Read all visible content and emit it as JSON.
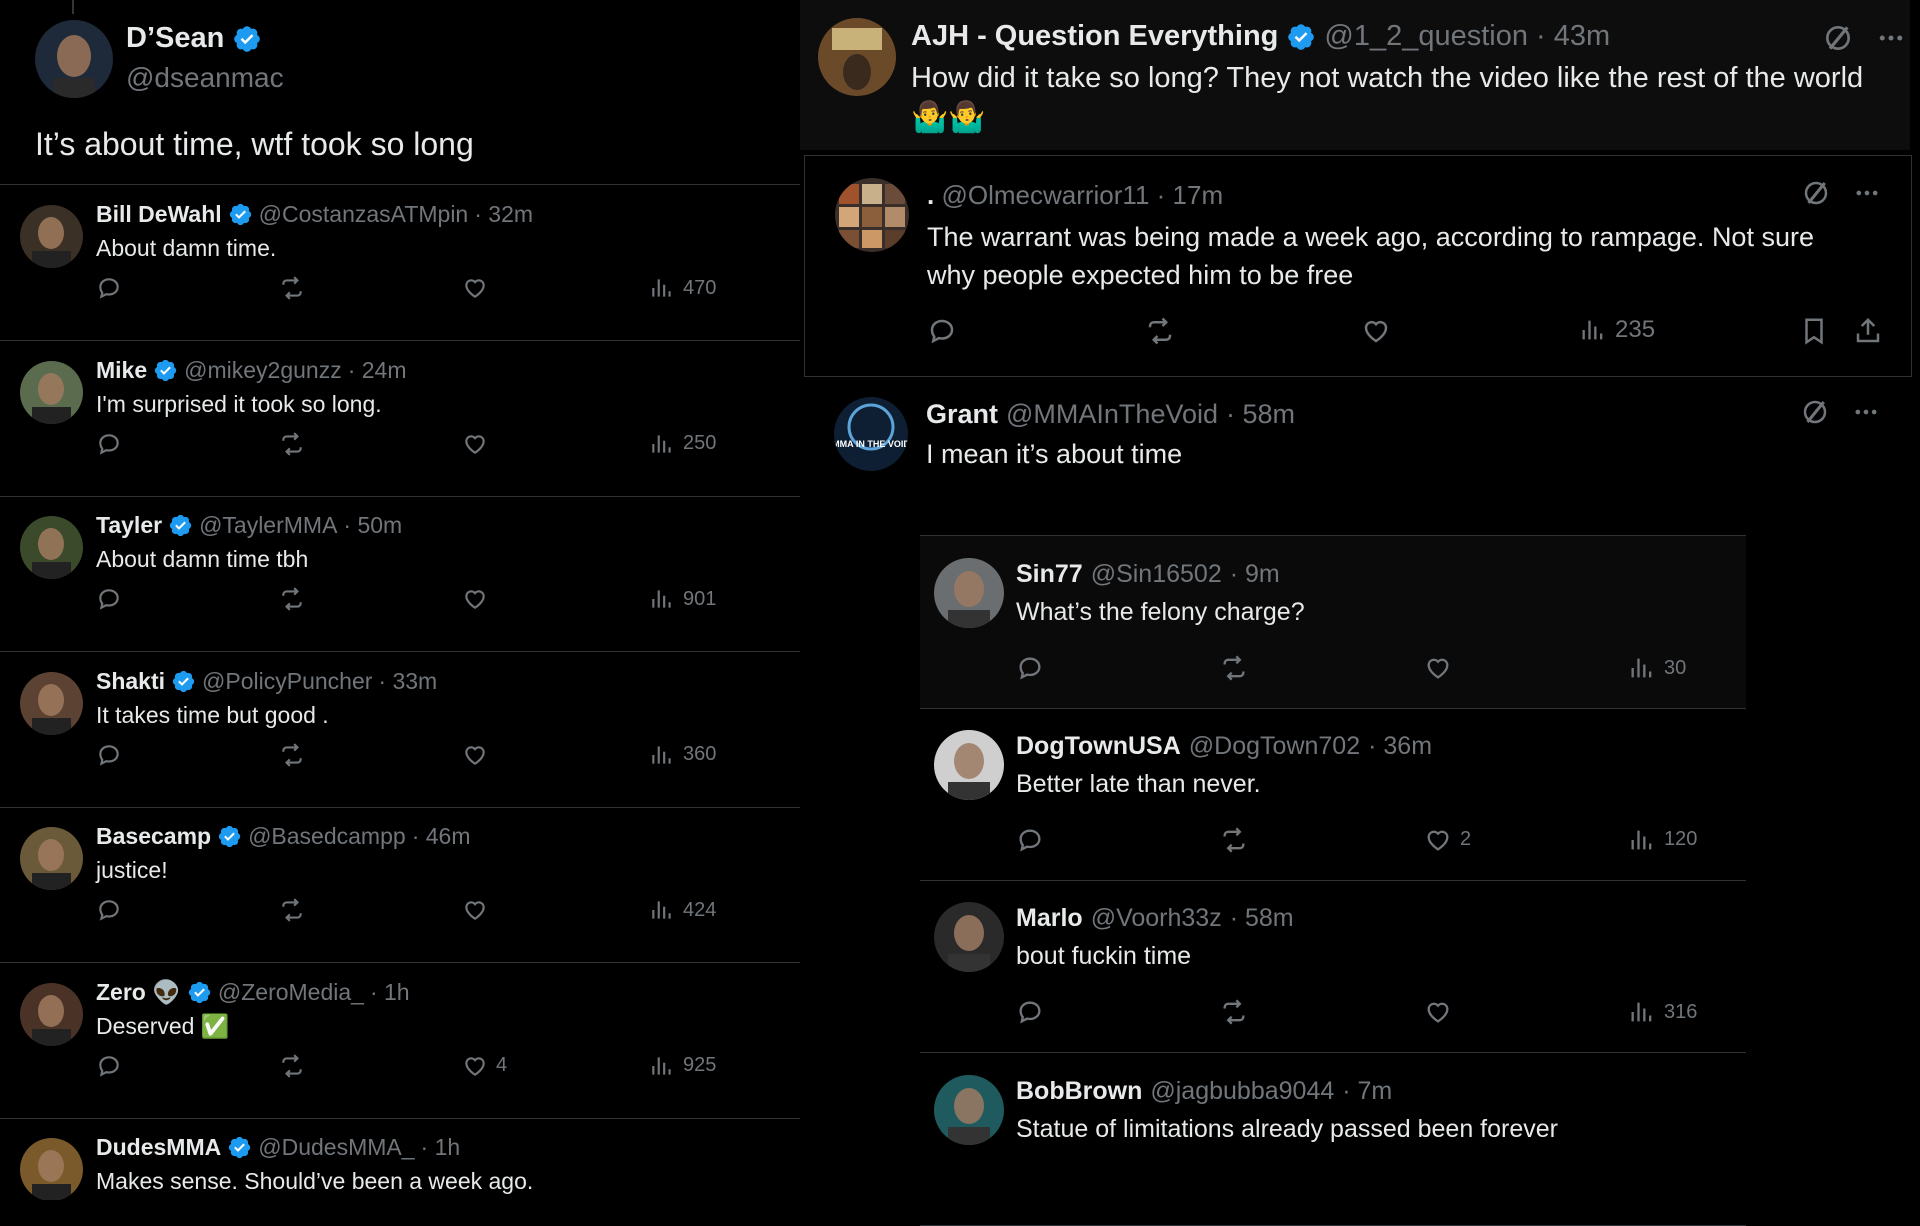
{
  "main_tweet": {
    "name": "D’Sean",
    "handle": "@dseanmac",
    "text": "It’s about time, wtf took so long"
  },
  "left_replies": [
    {
      "name": "Bill DeWahl",
      "handle": "@CostanzasATMpin",
      "time": "· 32m",
      "text": "About damn time.",
      "likes": "",
      "views": "470",
      "avatar_color": "#3a3026"
    },
    {
      "name": "Mike",
      "handle": "@mikey2gunzz",
      "time": "· 24m",
      "text": "I'm surprised it took so long.",
      "likes": "",
      "views": "250",
      "avatar_color": "#5a6b4e"
    },
    {
      "name": "Tayler",
      "handle": "@TaylerMMA",
      "time": "· 50m",
      "text": "About damn time tbh",
      "likes": "",
      "views": "901",
      "avatar_color": "#3b4a2a"
    },
    {
      "name": "Shakti",
      "handle": "@PolicyPuncher",
      "time": "· 33m",
      "text": "It takes time but good .",
      "likes": "",
      "views": "360",
      "avatar_color": "#5b4232"
    },
    {
      "name": "Basecamp",
      "handle": "@Basedcampp",
      "time": "· 46m",
      "text": "justice!",
      "likes": "",
      "views": "424",
      "avatar_color": "#6b5a3a"
    },
    {
      "name": "Zero 👽",
      "handle": "@ZeroMedia_",
      "time": "· 1h",
      "text": "Deserved ✅",
      "likes": "4",
      "views": "925",
      "avatar_color": "#4a3326"
    },
    {
      "name": "DudesMMA",
      "handle": "@DudesMMA_",
      "time": "· 1h",
      "text": "Makes sense. Should’ve been a week ago.",
      "likes": "",
      "views": "",
      "avatar_color": "#7a5a2a"
    }
  ],
  "ajh": {
    "name": "AJH - Question Everything",
    "handle": "@1_2_question",
    "time": "· 43m",
    "text": "How did it take so long? They not watch the video like the rest of the world",
    "emojis": "🤷‍♂️🤷‍♂️"
  },
  "olmec": {
    "name": ".",
    "handle": "@Olmecwarrior11",
    "time": "· 17m",
    "text": "The warrant was being made a week ago, according to rampage. Not sure why people expected him to be free",
    "views": "235"
  },
  "grant": {
    "name": "Grant",
    "handle": "@MMAInTheVoid",
    "time": "· 58m",
    "text": "I mean it’s about time",
    "avatar_text": "MMA IN THE VOID"
  },
  "right_replies": [
    {
      "name": "Sin77",
      "handle": "@Sin16502",
      "time": "· 9m",
      "text": "What’s the felony charge?",
      "likes": "",
      "views": "30",
      "avatar_color": "#6b6e70"
    },
    {
      "name": "DogTownUSA",
      "handle": "@DogTown702",
      "time": "· 36m",
      "text": "Better late than never.",
      "likes": "2",
      "views": "120",
      "avatar_color": "#cfcfcf"
    },
    {
      "name": "Marlo",
      "handle": "@Voorh33z",
      "time": "· 58m",
      "text": "bout fuckin time",
      "likes": "",
      "views": "316",
      "avatar_color": "#2a2a2a"
    },
    {
      "name": "BobBrown",
      "handle": "@jagbubba9044",
      "time": "· 7m",
      "text": "Statue of limitations already passed been forever",
      "likes": "",
      "views": "",
      "avatar_color": "#1f5b5e"
    }
  ],
  "colors": {
    "background": "#000000",
    "text": "#e7e9ea",
    "muted": "#71767b",
    "verified": "#1d9bf0",
    "divider": "#2f3336"
  }
}
